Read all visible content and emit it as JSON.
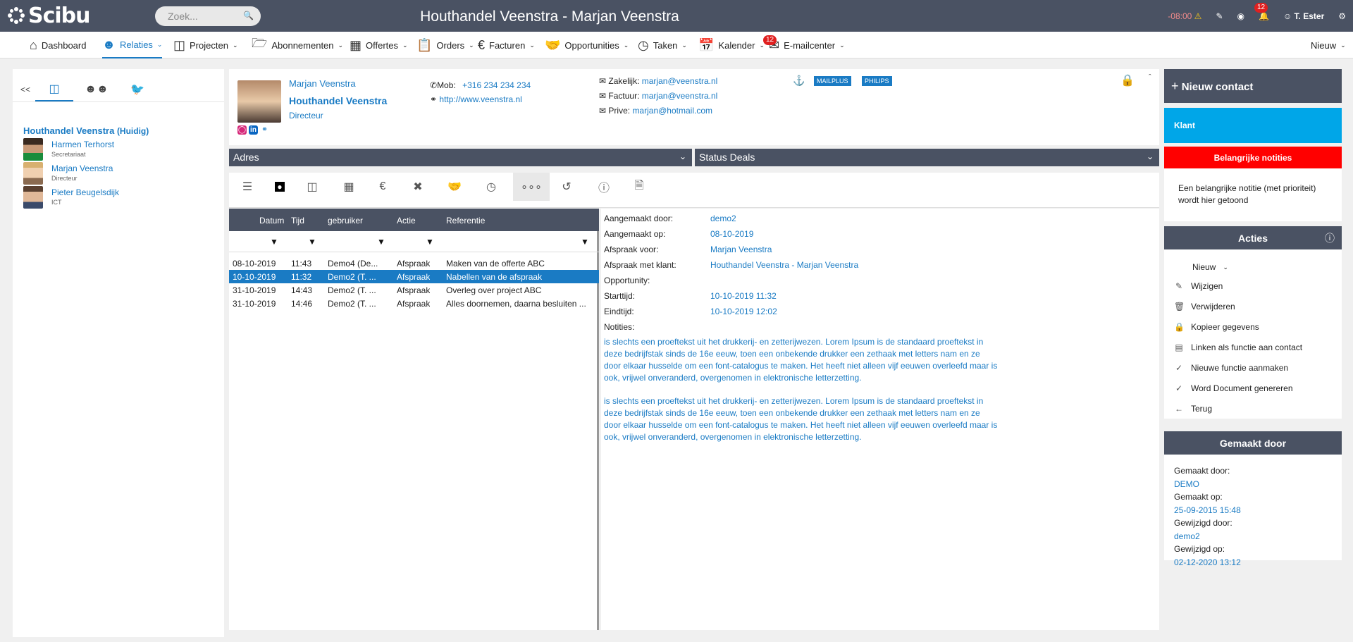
{
  "topbar": {
    "logo": "Scibu",
    "search_placeholder": "Zoek...",
    "title": "Houthandel Veenstra - Marjan Veenstra",
    "timer": "-08:00",
    "notification_count": "12",
    "user": "T. Ester"
  },
  "nav": {
    "items": [
      {
        "label": "Dashboard"
      },
      {
        "label": "Relaties"
      },
      {
        "label": "Projecten"
      },
      {
        "label": "Abonnementen"
      },
      {
        "label": "Offertes"
      },
      {
        "label": "Orders"
      },
      {
        "label": "Facturen"
      },
      {
        "label": "Opportunities"
      },
      {
        "label": "Taken"
      },
      {
        "label": "Kalender"
      },
      {
        "label": "E-mailcenter"
      }
    ],
    "email_badge": "12",
    "new_label": "Nieuw"
  },
  "left": {
    "back": "<<",
    "company": "Houthandel Veenstra",
    "company_suffix": "(Huidig)",
    "contacts": [
      {
        "name": "Harmen Terhorst",
        "role": "Secretariaat"
      },
      {
        "name": "Marjan Veenstra",
        "role": "Directeur"
      },
      {
        "name": "Pieter Beugelsdijk",
        "role": "ICT"
      }
    ]
  },
  "header": {
    "name": "Marjan Veenstra",
    "company": "Houthandel Veenstra",
    "role": "Directeur",
    "mob_label": "Mob:",
    "mob": "+316 234 234 234",
    "website": "http://www.veenstra.nl",
    "email_business_label": "Zakelijk:",
    "email_business": "marjan@veenstra.nl",
    "email_invoice_label": "Factuur:",
    "email_invoice": "marjan@veenstra.nl",
    "email_private_label": "Prive:",
    "email_private": "marjan@hotmail.com",
    "tags": [
      "MAILPLUS",
      "PHILIPS"
    ]
  },
  "sections": {
    "address": "Adres",
    "status_deals": "Status Deals"
  },
  "table": {
    "columns": [
      "Datum",
      "Tijd",
      "gebruiker",
      "Actie",
      "Referentie"
    ],
    "rows": [
      {
        "date": "08-10-2019",
        "time": "11:43",
        "user": "Demo4 (De...",
        "action": "Afspraak",
        "ref": "Maken van de offerte ABC"
      },
      {
        "date": "10-10-2019",
        "time": "11:32",
        "user": "Demo2 (T. ...",
        "action": "Afspraak",
        "ref": "Nabellen van de afspraak"
      },
      {
        "date": "31-10-2019",
        "time": "14:43",
        "user": "Demo2 (T. ...",
        "action": "Afspraak",
        "ref": "Overleg over project ABC"
      },
      {
        "date": "31-10-2019",
        "time": "14:46",
        "user": "Demo2 (T. ...",
        "action": "Afspraak",
        "ref": "Alles doornemen, daarna besluiten ..."
      }
    ]
  },
  "detail": {
    "created_by_label": "Aangemaakt door:",
    "created_by": "demo2",
    "created_on_label": "Aangemaakt op:",
    "created_on": "08-10-2019",
    "appointment_for_label": "Afspraak voor:",
    "appointment_for": "Marjan Veenstra",
    "appointment_with_label": "Afspraak met klant:",
    "appointment_with": "Houthandel Veenstra - Marjan Veenstra",
    "opportunity_label": "Opportunity:",
    "start_label": "Starttijd:",
    "start": "10-10-2019 11:32",
    "end_label": "Eindtijd:",
    "end": "10-10-2019 12:02",
    "notes_label": "Notities:",
    "notes": [
      "is slechts een proeftekst uit het drukkerij- en zetterijwezen. Lorem Ipsum is de standaard proeftekst in deze bedrijfstak sinds de 16e eeuw, toen een onbekende drukker een zethaak met letters nam en ze door elkaar husselde om een font-catalogus te maken. Het heeft niet alleen vijf eeuwen overleefd maar is ook, vrijwel onveranderd, overgenomen in elektronische letterzetting.",
      "is slechts een proeftekst uit het drukkerij- en zetterijwezen. Lorem Ipsum is de standaard proeftekst in deze bedrijfstak sinds de 16e eeuw, toen een onbekende drukker een zethaak met letters nam en ze door elkaar husselde om een font-catalogus te maken. Het heeft niet alleen vijf eeuwen overleefd maar is ook, vrijwel onveranderd, overgenomen in elektronische letterzetting."
    ]
  },
  "right": {
    "new_contact": "Nieuw contact",
    "client": "Klant",
    "important_notes": "Belangrijke notities",
    "important_note_text": "Een belangrijke notitie (met prioriteit) wordt hier getoond",
    "actions_title": "Acties",
    "actions_new": "Nieuw",
    "actions": [
      "Wijzigen",
      "Verwijderen",
      "Kopieer gegevens",
      "Linken als functie aan contact",
      "Nieuwe functie aanmaken",
      "Word Document genereren",
      "Terug"
    ],
    "made_by_title": "Gemaakt door",
    "made_by_label": "Gemaakt door:",
    "made_by": "DEMO",
    "made_on_label": "Gemaakt op:",
    "made_on": "25-09-2015 15:48",
    "modified_by_label": "Gewijzigd door:",
    "modified_by": "demo2",
    "modified_on_label": "Gewijzigd op:",
    "modified_on": "02-12-2020 13:12"
  },
  "colors": {
    "header_bg": "#4a5263",
    "accent": "#1a7bc4",
    "client": "#00a6e8",
    "important": "#ff0000"
  }
}
